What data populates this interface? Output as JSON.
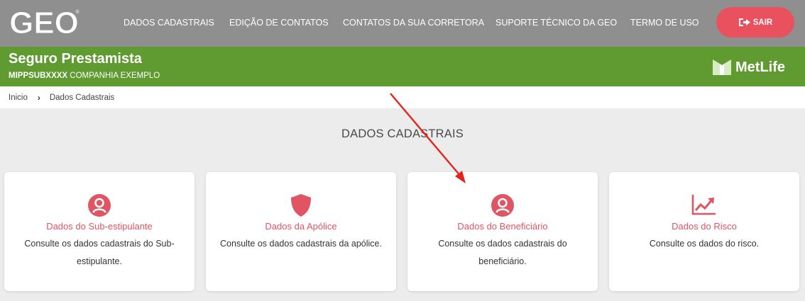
{
  "header": {
    "logo_text": "GEO",
    "nav": [
      "DADOS CADASTRAIS",
      "EDIÇÃO DE CONTATOS",
      "CONTATOS DA SUA CORRETORA",
      "SUPORTE TÉCNICO DA GEO",
      "TERMO DE USO"
    ],
    "logout_label": "SAIR",
    "logout_icon": "sign-out-icon"
  },
  "banner": {
    "title": "Seguro Prestamista",
    "policy_code": "MIPPSUBXXXX",
    "company": "COMPANHIA EXEMPLO",
    "brand": "MetLife"
  },
  "breadcrumb": {
    "home": "Inicio",
    "separator": "›",
    "current": "Dados Cadastrais"
  },
  "page": {
    "title": "DADOS CADASTRAIS"
  },
  "cards": [
    {
      "icon": "user-circle-icon",
      "title": "Dados do Sub-estipulante",
      "desc": "Consulte os dados cadastrais do Sub-estipulante."
    },
    {
      "icon": "shield-icon",
      "title": "Dados da Apólice",
      "desc": "Consulte os dados cadastrais da apólice."
    },
    {
      "icon": "user-circle-icon",
      "title": "Dados do Beneficiário",
      "desc": "Consulte os dados cadastrais do beneficiário."
    },
    {
      "icon": "chart-line-icon",
      "title": "Dados do Risco",
      "desc": "Consulte os dados do risco."
    }
  ],
  "colors": {
    "topbar": "#8f8f8f",
    "banner": "#5f9b31",
    "accent": "#e05463",
    "logout_button": "#e9515f",
    "annotation_arrow": "#e8231c"
  }
}
